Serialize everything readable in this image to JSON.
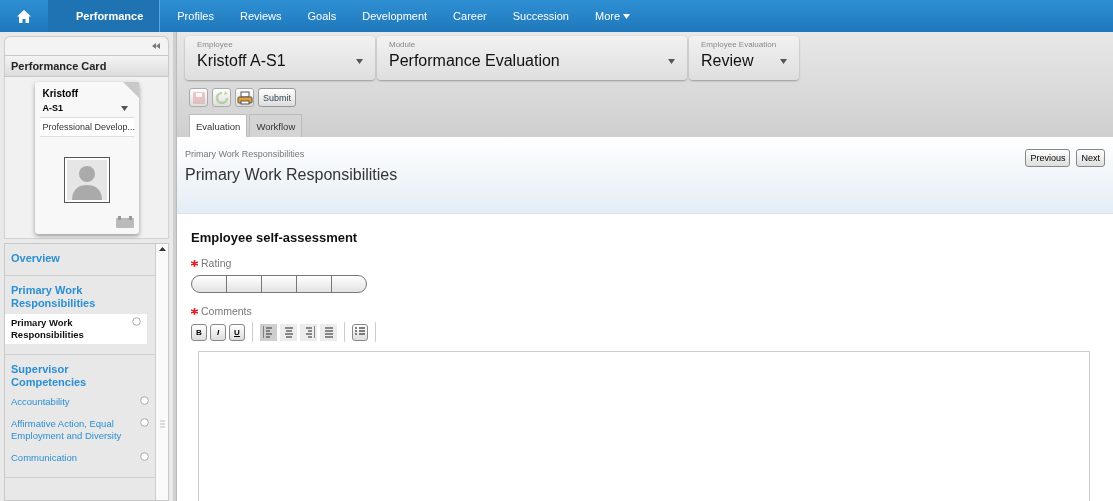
{
  "nav": {
    "items": [
      {
        "label": "Performance",
        "selected": true
      },
      {
        "label": "Profiles",
        "selected": false
      },
      {
        "label": "Reviews",
        "selected": false
      },
      {
        "label": "Goals",
        "selected": false
      },
      {
        "label": "Development",
        "selected": false
      },
      {
        "label": "Career",
        "selected": false
      },
      {
        "label": "Succession",
        "selected": false
      }
    ],
    "more": {
      "label": "More",
      "expanded": false
    }
  },
  "sidebar": {
    "card_title": "Performance Card",
    "card": {
      "name": "Kristoff",
      "id": "A-S1",
      "plan": "Professional Develop..."
    },
    "sections": [
      {
        "title": "Overview"
      },
      {
        "title": "Primary Work Responsibilities",
        "children": [
          {
            "label": "Primary Work Responsibilities",
            "selected": true
          }
        ]
      },
      {
        "title": "Supervisor Competencies",
        "children": [
          {
            "label": "Accountability",
            "selected": false
          },
          {
            "label": "Affirmative Action, Equal Employment and Diversity",
            "selected": false
          },
          {
            "label": "Communication",
            "selected": false
          }
        ]
      }
    ]
  },
  "selectors": [
    {
      "label": "Employee",
      "value": "Kristoff A-S1"
    },
    {
      "label": "Module",
      "value": "Performance Evaluation"
    },
    {
      "label": "Employee Evaluation",
      "value": "Review"
    }
  ],
  "toolbar": {
    "buttons": [
      {
        "kind": "save",
        "disabled": true
      },
      {
        "kind": "refresh",
        "disabled": true
      },
      {
        "kind": "print",
        "disabled": false
      }
    ],
    "submit": "Submit"
  },
  "tabs": [
    {
      "label": "Evaluation",
      "selected": true
    },
    {
      "label": "Workflow",
      "selected": false
    }
  ],
  "header": {
    "breadcrumb": "Primary Work Responsibilities",
    "title": "Primary Work Responsibilities",
    "buttons": [
      "Previous",
      "Next"
    ]
  },
  "form": {
    "title": "Employee self-assessment",
    "rating": {
      "label": "Rating",
      "required": true,
      "segments": [
        {
          "selected": false
        },
        {
          "selected": false
        },
        {
          "selected": false
        },
        {
          "selected": false
        },
        {
          "selected": false
        }
      ]
    },
    "comments": {
      "label": "Comments",
      "required": true,
      "format_buttons": [
        "B",
        "I",
        "U"
      ],
      "align_buttons": [
        {
          "kind": "left",
          "selected": true
        },
        {
          "kind": "center",
          "selected": false
        },
        {
          "kind": "right",
          "selected": false
        },
        {
          "kind": "justify",
          "selected": false
        }
      ]
    }
  }
}
